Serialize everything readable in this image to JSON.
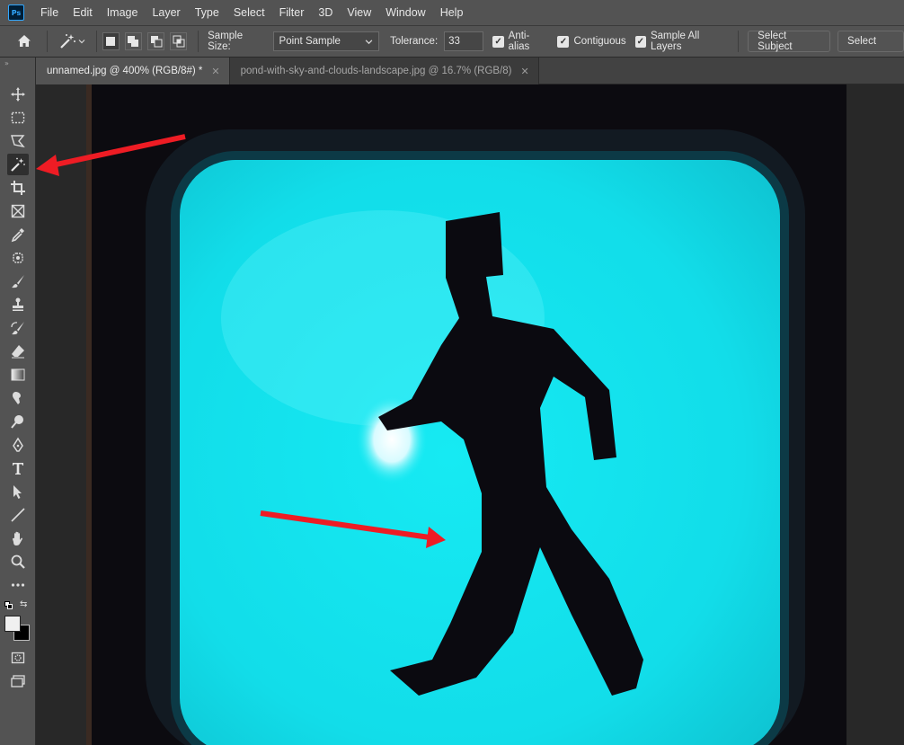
{
  "app": {
    "logo_text": "Ps"
  },
  "menu": [
    "File",
    "Edit",
    "Image",
    "Layer",
    "Type",
    "Select",
    "Filter",
    "3D",
    "View",
    "Window",
    "Help"
  ],
  "options": {
    "sample_size_label": "Sample Size:",
    "sample_size_value": "Point Sample",
    "tolerance_label": "Tolerance:",
    "tolerance_value": "33",
    "anti_alias_label": "Anti-alias",
    "contiguous_label": "Contiguous",
    "sample_all_layers_label": "Sample All Layers",
    "select_subject_label": "Select Subject",
    "select_label": "Select"
  },
  "tabs": [
    {
      "label": "unnamed.jpg @ 400% (RGB/8#) *",
      "active": true
    },
    {
      "label": "pond-with-sky-and-clouds-landscape.jpg @ 16.7% (RGB/8)",
      "active": false
    }
  ],
  "tools": [
    "move-tool",
    "marquee-tool",
    "lasso-tool",
    "magic-wand-tool",
    "crop-tool",
    "frame-tool",
    "eyedropper-tool",
    "healing-tool",
    "brush-tool",
    "stamp-tool",
    "history-brush-tool",
    "eraser-tool",
    "gradient-tool",
    "blur-tool",
    "dodge-tool",
    "pen-tool",
    "type-tool",
    "path-selection-tool",
    "line-tool",
    "hand-tool",
    "zoom-tool",
    "more-tools",
    "color-swatches",
    "quick-mask",
    "screen-mode"
  ],
  "active_tool": "magic-wand-tool",
  "colors": {
    "signal": "#13e4ef",
    "annotation_arrow": "#ee1c24",
    "ui_panel": "#535353"
  }
}
